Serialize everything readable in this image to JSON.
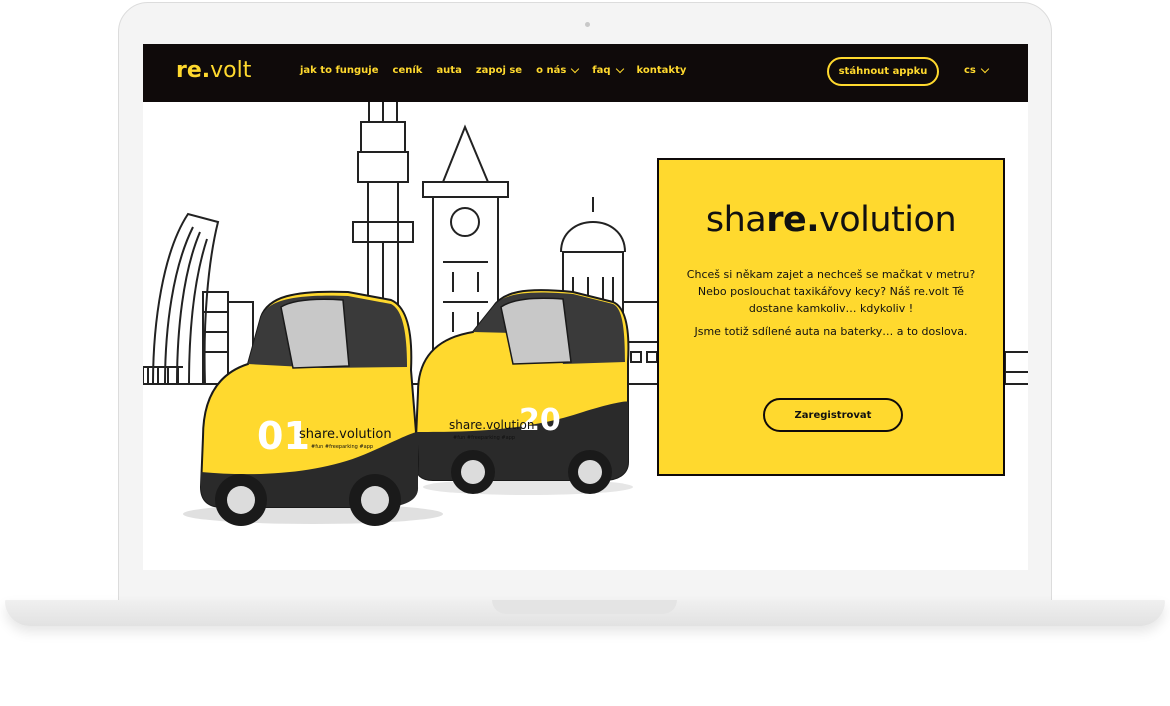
{
  "header": {
    "logo_prefix": "re.",
    "logo_suffix": "volt",
    "nav": [
      {
        "label": "jak to funguje",
        "dropdown": false
      },
      {
        "label": "ceník",
        "dropdown": false
      },
      {
        "label": "auta",
        "dropdown": false
      },
      {
        "label": "zapoj se",
        "dropdown": false
      },
      {
        "label": "o nás",
        "dropdown": true
      },
      {
        "label": "faq",
        "dropdown": true
      },
      {
        "label": "kontakty",
        "dropdown": false
      }
    ],
    "cta_label": "stáhnout appku",
    "language": "cs"
  },
  "hero": {
    "brand_start": "sha",
    "brand_bold": "re.",
    "brand_end": "volution",
    "paragraph_1": "Chceš si někam zajet a nechceš se mačkat v metru? Nebo poslouchat taxikářovy kecy? Náš re.volt Tě dostane kamkoliv… kdykoliv !",
    "paragraph_2": "Jsme totiž sdílené auta na baterky… a to doslova.",
    "register_label": "Zaregistrovat"
  },
  "cars": [
    {
      "number": "01",
      "brand": "share.volution",
      "tagline": "#fun #freeparking #app"
    },
    {
      "number": "20",
      "brand": "share.volution",
      "tagline": "#fun #freeparking #app"
    }
  ],
  "colors": {
    "accent": "#ffd92e",
    "dark": "#0f0a0a"
  }
}
